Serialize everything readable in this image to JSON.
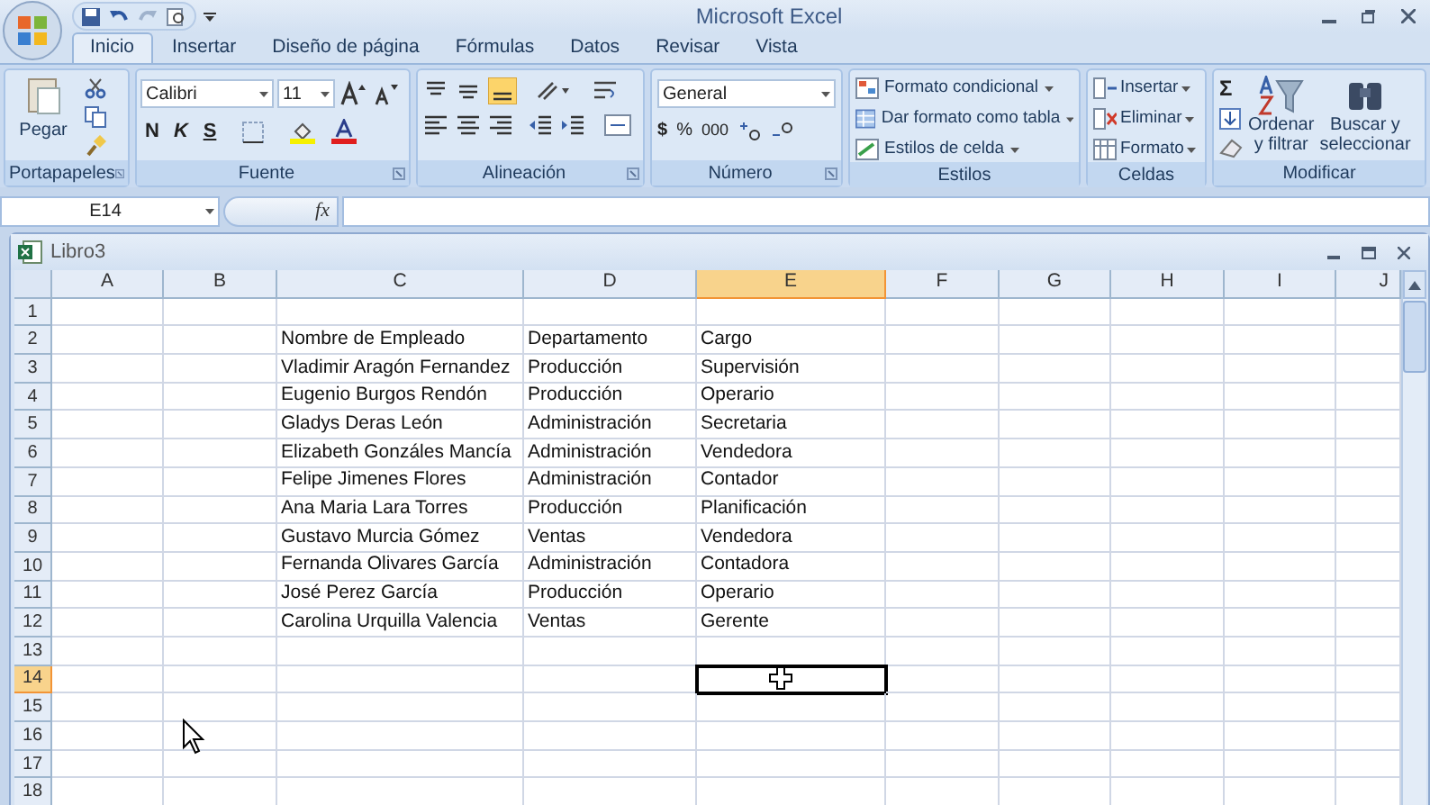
{
  "title_bar": {
    "title": "Microsoft Excel"
  },
  "tabs": [
    {
      "label": "Inicio",
      "selected": true
    },
    {
      "label": "Insertar",
      "selected": false
    },
    {
      "label": "Diseño de página",
      "selected": false
    },
    {
      "label": "Fórmulas",
      "selected": false
    },
    {
      "label": "Datos",
      "selected": false
    },
    {
      "label": "Revisar",
      "selected": false
    },
    {
      "label": "Vista",
      "selected": false
    }
  ],
  "ribbon": {
    "clipboard": {
      "label": "Portapapeles",
      "paste": "Pegar"
    },
    "font": {
      "label": "Fuente",
      "font_name": "Calibri",
      "font_size": "11",
      "bold": "N",
      "italic": "K",
      "underline": "S"
    },
    "alignment": {
      "label": "Alineación"
    },
    "number": {
      "label": "Número",
      "format": "General",
      "currency": "$",
      "percent": "%",
      "thousands": "000"
    },
    "styles": {
      "label": "Estilos",
      "items": [
        "Formato condicional",
        "Dar formato como tabla",
        "Estilos de celda"
      ]
    },
    "cells": {
      "label": "Celdas",
      "items": [
        "Insertar",
        "Eliminar",
        "Formato"
      ]
    },
    "editing": {
      "label": "Modificar",
      "sum": "Σ",
      "sort_lines": [
        "Ordenar",
        "y filtrar"
      ],
      "find_lines": [
        "Buscar y",
        "seleccionar"
      ]
    }
  },
  "formula_bar": {
    "name_box": "E14",
    "fx": "fx"
  },
  "workbook": {
    "title": "Libro3",
    "columns": [
      {
        "label": "A",
        "selected": false
      },
      {
        "label": "B",
        "selected": false
      },
      {
        "label": "C",
        "selected": false
      },
      {
        "label": "D",
        "selected": false
      },
      {
        "label": "E",
        "selected": true
      },
      {
        "label": "F",
        "selected": false
      },
      {
        "label": "G",
        "selected": false
      },
      {
        "label": "H",
        "selected": false
      },
      {
        "label": "I",
        "selected": false
      },
      {
        "label": "J",
        "selected": false
      }
    ],
    "rows": [
      {
        "number": "1",
        "selected": false
      },
      {
        "number": "2",
        "selected": false,
        "cells": {
          "C": "Nombre de Empleado",
          "D": "Departamento",
          "E": "Cargo"
        }
      },
      {
        "number": "3",
        "selected": false,
        "cells": {
          "C": "Vladimir Aragón Fernandez",
          "D": "Producción",
          "E": "Supervisión"
        }
      },
      {
        "number": "4",
        "selected": false,
        "cells": {
          "C": "Eugenio Burgos Rendón",
          "D": "Producción",
          "E": "Operario"
        }
      },
      {
        "number": "5",
        "selected": false,
        "cells": {
          "C": "Gladys Deras León",
          "D": "Administración",
          "E": "Secretaria"
        }
      },
      {
        "number": "6",
        "selected": false,
        "cells": {
          "C": "Elizabeth Gonzáles Mancía",
          "D": "Administración",
          "E": "Vendedora"
        }
      },
      {
        "number": "7",
        "selected": false,
        "cells": {
          "C": "Felipe Jimenes Flores",
          "D": "Administración",
          "E": "Contador"
        }
      },
      {
        "number": "8",
        "selected": false,
        "cells": {
          "C": "Ana Maria Lara Torres",
          "D": "Producción",
          "E": "Planificación"
        }
      },
      {
        "number": "9",
        "selected": false,
        "cells": {
          "C": "Gustavo Murcia Gómez",
          "D": "Ventas",
          "E": "Vendedora"
        }
      },
      {
        "number": "10",
        "selected": false,
        "cells": {
          "C": "Fernanda Olivares García",
          "D": "Administración",
          "E": "Contadora"
        }
      },
      {
        "number": "11",
        "selected": false,
        "cells": {
          "C": "José Perez García",
          "D": "Producción",
          "E": "Operario"
        }
      },
      {
        "number": "12",
        "selected": false,
        "cells": {
          "C": "Carolina Urquilla Valencia",
          "D": "Ventas",
          "E": "Gerente"
        }
      },
      {
        "number": "13",
        "selected": false
      },
      {
        "number": "14",
        "selected": true
      },
      {
        "number": "15",
        "selected": false
      },
      {
        "number": "16",
        "selected": false
      },
      {
        "number": "17",
        "selected": false
      },
      {
        "number": "18",
        "selected": false
      }
    ]
  }
}
